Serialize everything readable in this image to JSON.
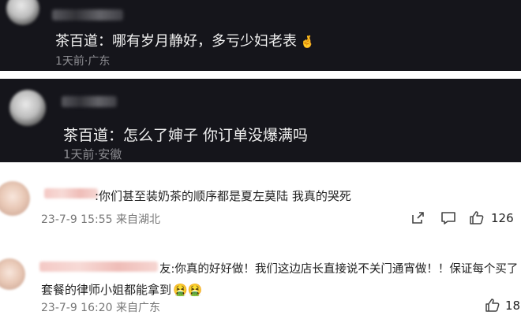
{
  "comments_dark": [
    {
      "text": "茶百道：哪有岁月静好，多亏少妇老表",
      "emoji": "🤞",
      "meta": "1天前·广东"
    },
    {
      "text": "茶百道：怎么了婶子 你订单没爆满吗",
      "meta": "1天前·安徽"
    }
  ],
  "comments_light": [
    {
      "text": ":你们甚至装奶茶的顺序都是夏左莫陆 我真的哭死",
      "meta": "23-7-9 15:55 来自湖北",
      "likes": "126"
    },
    {
      "text_line1": "友:你真的好好做！我们这边店长直接说不关门通宵做！！保证每个买了",
      "text_line2": "套餐的律师小姐都能拿到",
      "emojis": "🤮🤮",
      "meta": "23-7-9 16:20 来自广东",
      "likes": "18"
    }
  ],
  "icons": [
    "share-icon",
    "comment-icon",
    "like-icon"
  ],
  "colors": {
    "dark_bg": "#15151b",
    "light_bg": "#ffffff"
  }
}
